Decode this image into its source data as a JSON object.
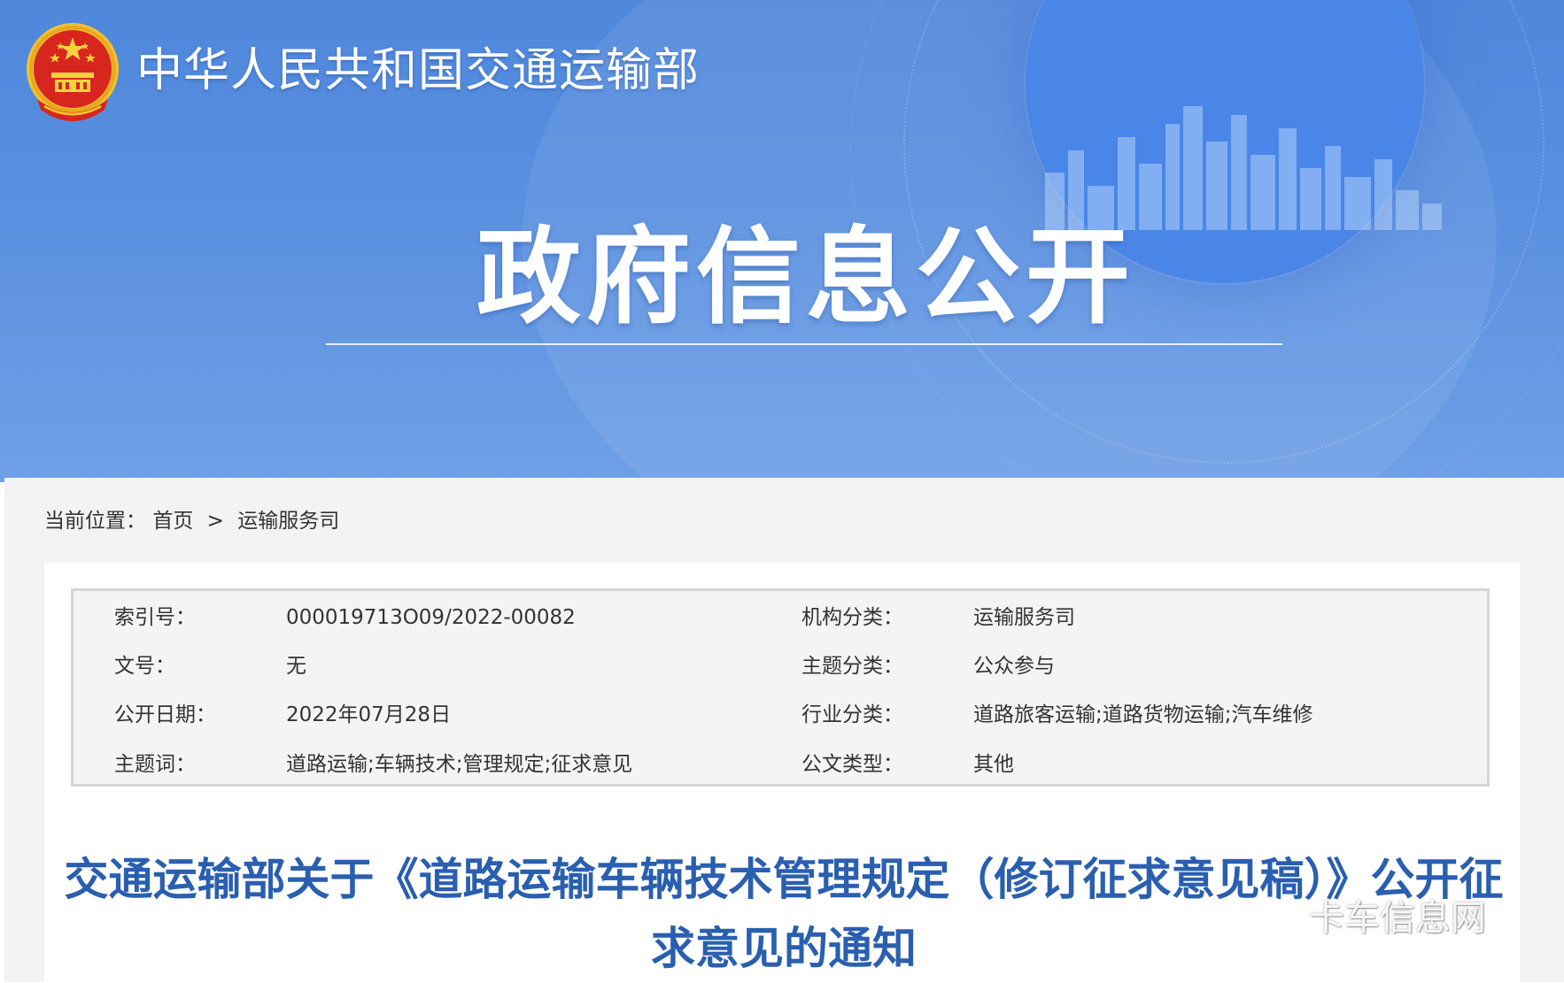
{
  "header": {
    "ministry_name": "中华人民共和国交通运输部",
    "section_title": "政府信息公开"
  },
  "breadcrumb": {
    "label": "当前位置：",
    "items": [
      "首页",
      "运输服务司"
    ],
    "separator": ">"
  },
  "info_table": {
    "rows": [
      {
        "label1": "索引号：",
        "value1": "000019713O09/2022-00082",
        "label2": "机构分类：",
        "value2": "运输服务司"
      },
      {
        "label1": "文号：",
        "value1": "无",
        "label2": "主题分类：",
        "value2": "公众参与"
      },
      {
        "label1": "公开日期：",
        "value1": "2022年07月28日",
        "label2": "行业分类：",
        "value2": "道路旅客运输;道路货物运输;汽车维修"
      },
      {
        "label1": "主题词：",
        "value1": "道路运输;车辆技术;管理规定;征求意见",
        "label2": "公文类型：",
        "value2": "其他"
      }
    ]
  },
  "article": {
    "title": "交通运输部关于《道路运输车辆技术管理规定（修订征求意见稿）》公开征求意见的通知"
  },
  "watermark": {
    "text": "卡车信息网"
  },
  "colors": {
    "banner_blue": "#4f87db",
    "title_blue": "#2a5fb0",
    "content_gray": "#f3f3f3"
  },
  "icons": [
    "national-emblem-icon",
    "wechat-icon"
  ]
}
